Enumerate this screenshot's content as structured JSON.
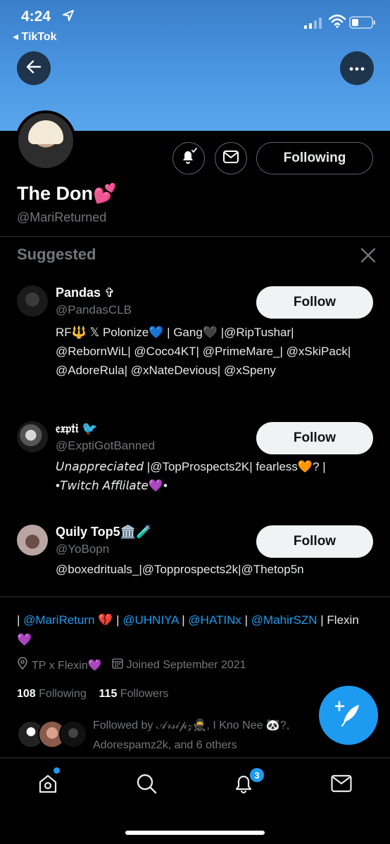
{
  "status_bar": {
    "time": "4:24",
    "back_app": "◂ TikTok"
  },
  "profile": {
    "display_name": "The Don💕",
    "handle": "@MariReturned",
    "following_label": "Following",
    "mentions": [
      {
        "text": "| ",
        "link": false
      },
      {
        "text": "@MariReturn",
        "link": true
      },
      {
        "text": " 💔 | ",
        "link": false
      },
      {
        "text": "@UHNIYA",
        "link": true
      },
      {
        "text": " | ",
        "link": false
      },
      {
        "text": "@HATINx",
        "link": true
      },
      {
        "text": " | ",
        "link": false
      },
      {
        "text": "@MahirSZN",
        "link": true
      },
      {
        "text": " | Flexin💜",
        "link": false
      }
    ],
    "location": "TP x Flexin💜",
    "joined": "Joined September 2021",
    "following_count": "108",
    "following_word": "Following",
    "followers_count": "115",
    "followers_word": "Followers",
    "followed_by": "Followed by 𝒜𝓇𝓈𝒾𝓅𝓏🥷, I Kno Nee 🐼?, Adorespamz2k, and 6 others"
  },
  "suggested": {
    "title": "Suggested",
    "items": [
      {
        "name": "Pandas ✞",
        "handle": "@PandasCLB",
        "bio": "RF🔱 𝕏 Polonize💙 | Gang🖤 |@RipTushar| @RebornWiL| @Coco4KT| @PrimeMare_| @xSkiPack| @AdoreRula| @xNateDevious| @xSpeny",
        "follow_label": "Follow"
      },
      {
        "name": "𝔢𝔵𝔭𝔱𝔦 🐦",
        "handle": "@ExptiGotBanned",
        "bio": "𝘜𝘯𝘢𝘱𝘱𝘳𝘦𝘤𝘪𝘢𝘵𝘦𝘥 |@TopProspects2K| fearless🧡? | •𝘛𝘸𝘪𝘵𝘤𝘩 𝘈𝘧𝘧𝘭𝘪𝘭𝘢𝘵𝘦💜•",
        "follow_label": "Follow"
      },
      {
        "name": "Quily Top5🏛️🧪",
        "handle": "@YoBopn",
        "bio": "@boxedrituals_|@Topprospects2k|@Thetop5n",
        "follow_label": "Follow"
      }
    ]
  },
  "tabbar": {
    "notifications_badge": "3"
  },
  "colors": {
    "accent": "#1d9bf0",
    "banner": "#4a96e2",
    "background": "#000000",
    "muted": "#71767b"
  }
}
